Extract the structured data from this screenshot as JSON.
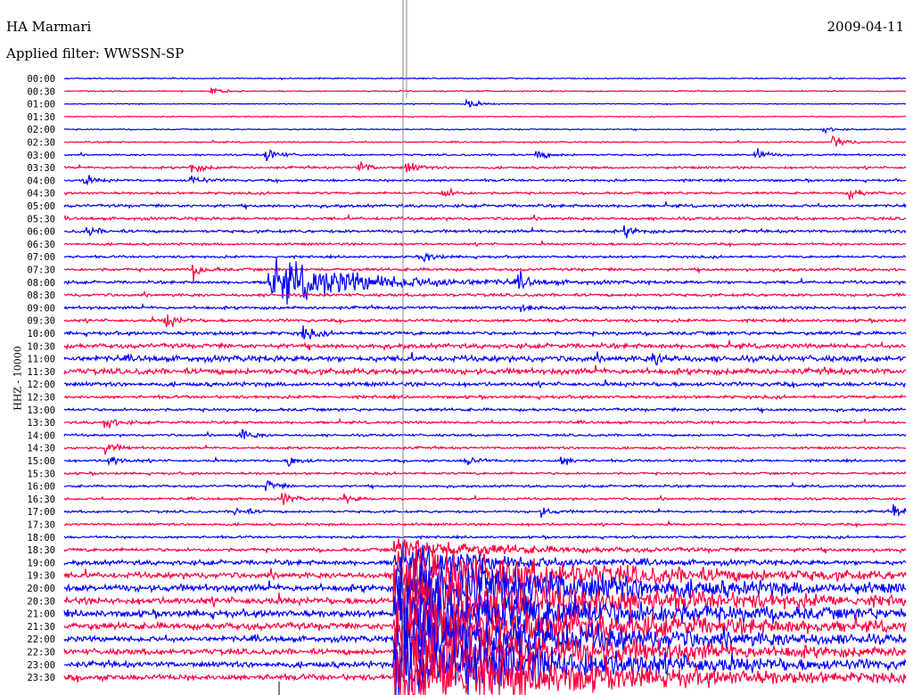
{
  "header": {
    "station": "HA Marmari",
    "filter": "Applied filter: WWSSN-SP",
    "date": "2009-04-11",
    "channel_label": "HHZ - 10000"
  },
  "chart_data": {
    "type": "line",
    "title": "HA Marmari 2009-04-11",
    "ylabel": "HHZ - 10000",
    "row_minutes": 30,
    "colors": {
      "even": "#0000ff",
      "odd": "#ff0040",
      "marker": "#888888"
    },
    "rows": [
      "00:00",
      "00:30",
      "01:00",
      "01:30",
      "02:00",
      "02:30",
      "03:00",
      "03:30",
      "04:00",
      "04:30",
      "05:00",
      "05:30",
      "06:00",
      "06:30",
      "07:00",
      "07:30",
      "08:00",
      "08:30",
      "09:00",
      "09:30",
      "10:00",
      "10:30",
      "11:00",
      "11:30",
      "12:00",
      "12:30",
      "13:00",
      "13:30",
      "14:00",
      "14:30",
      "15:00",
      "15:30",
      "16:00",
      "16:30",
      "17:00",
      "17:30",
      "18:00",
      "18:30",
      "19:00",
      "19:30",
      "20:00",
      "20:30",
      "21:00",
      "21:30",
      "22:00",
      "22:30",
      "23:00",
      "23:30"
    ],
    "noise_levels": [
      1,
      1,
      0.8,
      0.8,
      1,
      1.2,
      1.5,
      2,
      2,
      2,
      2.5,
      2.5,
      2.5,
      2,
      2,
      2.5,
      2.5,
      2.5,
      2.5,
      2.5,
      3,
      4,
      5,
      5,
      3.5,
      2.5,
      2.5,
      2.2,
      2,
      2,
      2,
      2,
      2,
      2,
      2,
      2,
      2,
      3,
      4,
      5,
      6,
      6,
      6,
      6,
      5,
      5,
      5,
      5
    ],
    "events": [
      {
        "row": 1,
        "minute": 5.2,
        "amp": 7
      },
      {
        "row": 2,
        "minute": 14.3,
        "amp": 10
      },
      {
        "row": 4,
        "minute": 27.0,
        "amp": 6
      },
      {
        "row": 5,
        "minute": 27.4,
        "amp": 14
      },
      {
        "row": 6,
        "minute": 7.2,
        "amp": 14
      },
      {
        "row": 6,
        "minute": 16.8,
        "amp": 10
      },
      {
        "row": 6,
        "minute": 24.6,
        "amp": 14
      },
      {
        "row": 7,
        "minute": 4.5,
        "amp": 10
      },
      {
        "row": 7,
        "minute": 10.5,
        "amp": 10
      },
      {
        "row": 7,
        "minute": 12.2,
        "amp": 10
      },
      {
        "row": 8,
        "minute": 0.7,
        "amp": 8
      },
      {
        "row": 8,
        "minute": 4.5,
        "amp": 9
      },
      {
        "row": 9,
        "minute": 13.5,
        "amp": 10
      },
      {
        "row": 9,
        "minute": 28.0,
        "amp": 10
      },
      {
        "row": 12,
        "minute": 0.8,
        "amp": 8
      },
      {
        "row": 12,
        "minute": 20.0,
        "amp": 9
      },
      {
        "row": 15,
        "minute": 4.6,
        "amp": 12
      },
      {
        "row": 14,
        "minute": 12.8,
        "amp": 10
      },
      {
        "row": 16,
        "minute": 7.3,
        "amp": 38
      },
      {
        "row": 16,
        "minute": 16.2,
        "amp": 12
      },
      {
        "row": 19,
        "minute": 3.6,
        "amp": 14
      },
      {
        "row": 18,
        "minute": 16.3,
        "amp": 12
      },
      {
        "row": 20,
        "minute": 8.5,
        "amp": 12
      },
      {
        "row": 22,
        "minute": 21.0,
        "amp": 10
      },
      {
        "row": 27,
        "minute": 1.4,
        "amp": 12
      },
      {
        "row": 28,
        "minute": 6.3,
        "amp": 10
      },
      {
        "row": 29,
        "minute": 1.5,
        "amp": 10
      },
      {
        "row": 30,
        "minute": 1.6,
        "amp": 10
      },
      {
        "row": 30,
        "minute": 8.0,
        "amp": 10
      },
      {
        "row": 30,
        "minute": 14.3,
        "amp": 10
      },
      {
        "row": 30,
        "minute": 17.7,
        "amp": 8
      },
      {
        "row": 32,
        "minute": 7.2,
        "amp": 10
      },
      {
        "row": 33,
        "minute": 7.8,
        "amp": 10
      },
      {
        "row": 33,
        "minute": 10.0,
        "amp": 8
      },
      {
        "row": 34,
        "minute": 6.1,
        "amp": 10
      },
      {
        "row": 34,
        "minute": 17.0,
        "amp": 8
      },
      {
        "row": 34,
        "minute": 29.6,
        "amp": 10
      },
      {
        "row": 37,
        "minute": 11.8,
        "amp": 20
      },
      {
        "row": 38,
        "minute": 11.8,
        "amp": 30
      },
      {
        "row": 39,
        "minute": 11.8,
        "amp": 45
      },
      {
        "row": 40,
        "minute": 11.8,
        "amp": 55
      },
      {
        "row": 41,
        "minute": 11.8,
        "amp": 60
      },
      {
        "row": 42,
        "minute": 11.8,
        "amp": 60
      },
      {
        "row": 43,
        "minute": 11.8,
        "amp": 60
      },
      {
        "row": 44,
        "minute": 11.8,
        "amp": 60
      },
      {
        "row": 45,
        "minute": 11.8,
        "amp": 60
      },
      {
        "row": 46,
        "minute": 11.8,
        "amp": 60
      },
      {
        "row": 47,
        "minute": 11.8,
        "amp": 60
      }
    ]
  }
}
